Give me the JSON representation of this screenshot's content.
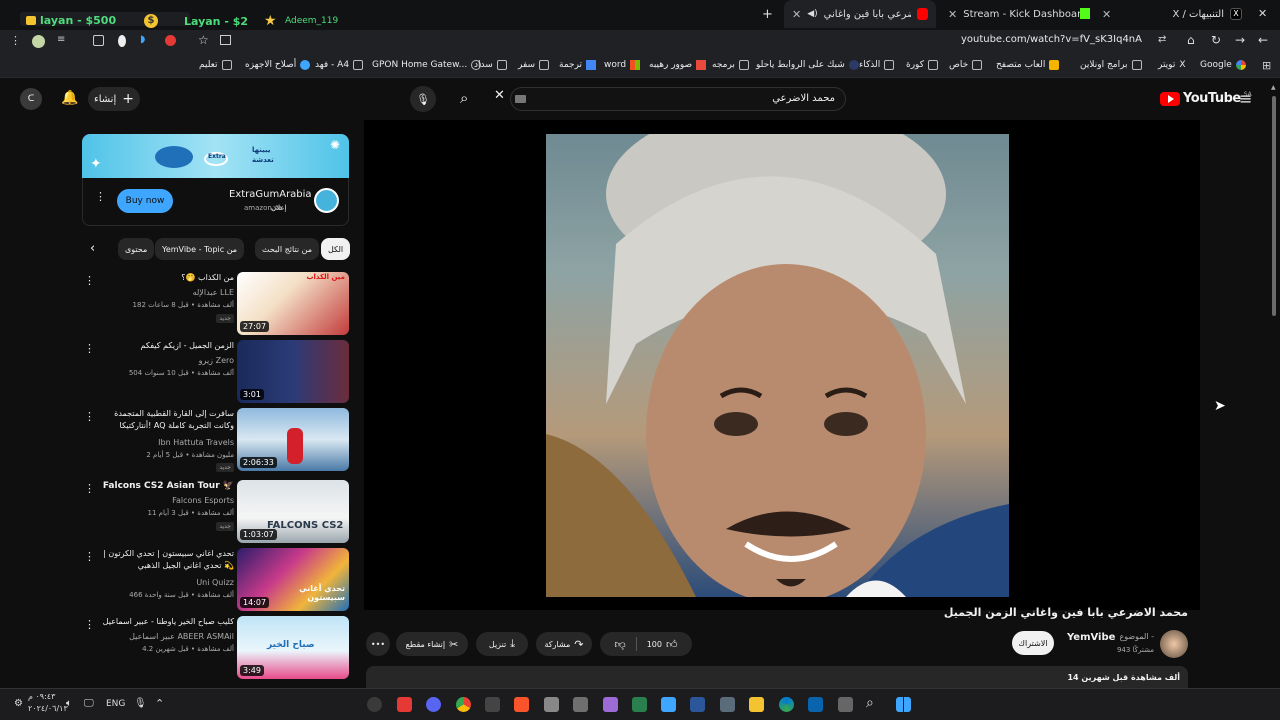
{
  "tabs": [
    {
      "title": "X / التنبيهات",
      "fav_color": "#000000"
    },
    {
      "title": "Stream - Kick Dashboard",
      "fav_color": "#53fc18"
    },
    {
      "title": "محمد الاضرعي بابا فين واغاني",
      "fav_color": "#ff0000"
    }
  ],
  "top_widgets": {
    "w1": "layan - $500",
    "w2": "Layan - $2",
    "w3": "Adeem_119"
  },
  "address_bar": {
    "url": "youtube.com/watch?v=fV_sK3Iq4nA"
  },
  "bookmarks": [
    "Google",
    "تويتر",
    "برامج اونلاين",
    "العاب متصفح",
    "خاص",
    "كورة",
    "الذكاء",
    "شبك على الروابط ياحلو",
    "برمجه",
    "صوور رهيبه",
    "word",
    "ترجمة",
    "سفر",
    "سداد",
    "GPON Home Gatew...",
    "فهد - A4",
    "أصلاح الاجهزه",
    "تعليم"
  ],
  "youtube": {
    "logo_text": "YouTube",
    "logo_region": "SA",
    "search_value": "محمد الاضرعي",
    "create_label": "إنشاء"
  },
  "ad": {
    "banner_line1": "يبينها",
    "banner_line2": "تعدشة",
    "banner_brand": "Extra",
    "title": "ExtraGumArabia",
    "domain": "amazon.sa",
    "sponsored": "إعلان",
    "cta": "Buy now"
  },
  "chips": [
    "الكل",
    "من نتائج البحث",
    "YemVibe - Topic من",
    "محتوى"
  ],
  "recommendations": [
    {
      "title": "من الكذاب 🤭؟",
      "channel": "عبدالإله LLE",
      "meta": "182 ألف مشاهدة • قبل 8 ساعات",
      "new": "جديد",
      "duration": "27:07",
      "thumb_text": "مين الكذاب"
    },
    {
      "title": "الزمن الجميل - ازيكم كيفكم",
      "channel": "زيرو Zero",
      "meta": "504 آلف مشاهدة • قبل 10 سنوات",
      "new": "",
      "duration": "3:01",
      "thumb_text": ""
    },
    {
      "title": "سافرت إلى القارة القطبية المتجمدة أنتاركتيكا! AQ وكانت التجربة كاملة",
      "channel": "Ibn Hattuta Travels",
      "meta": "2 مليون مشاهدة • قبل 5 أيام",
      "new": "جديد",
      "duration": "2:06:33",
      "thumb_text": ""
    },
    {
      "title": "Falcons CS2 Asian Tour 🦅",
      "channel": "Falcons Esports",
      "meta": "11 ألف مشاهدة • قبل 3 أيام",
      "new": "جديد",
      "duration": "1:03:07",
      "thumb_text": "FALCONS CS2"
    },
    {
      "title": "تحدي اغاني سبيستون | تحدي الكرتون | تحدي اغاني الجيل الذهبي 💫",
      "channel": "Uni Quizz",
      "meta": "466 ألف مشاهدة • قبل سنة واحدة",
      "new": "",
      "duration": "14:07",
      "thumb_text": "تحدي أغاني سبيستون"
    },
    {
      "title": "كليب صباح الخير ياوطنا - عبير اسماعيل",
      "channel": "عبير اسماعيل ABEER ASMAil",
      "meta": "4.2 ألف مشاهدة • قبل شهرين",
      "new": "",
      "duration": "3:49",
      "thumb_text": "صباح الخير"
    }
  ],
  "video": {
    "title": "محمد الاضرعي بابا فين واغاني الزمن الجميل",
    "channel": "YemVibe",
    "channel_prefix": "الموضوع -",
    "subscribers": "943 مشتركًا",
    "subscribe_label": "الاشتراك",
    "likes": "100",
    "share_label": "مشاركة",
    "download_label": "تنزيل",
    "clip_label": "إنشاء مقطع",
    "description_meta": "14 ألف مشاهدة قبل شهرين"
  },
  "taskbar": {
    "time": "٠٩:٤٣ م",
    "date": "٢٠٢٤/٠٦/١٣",
    "lang": "ENG"
  }
}
